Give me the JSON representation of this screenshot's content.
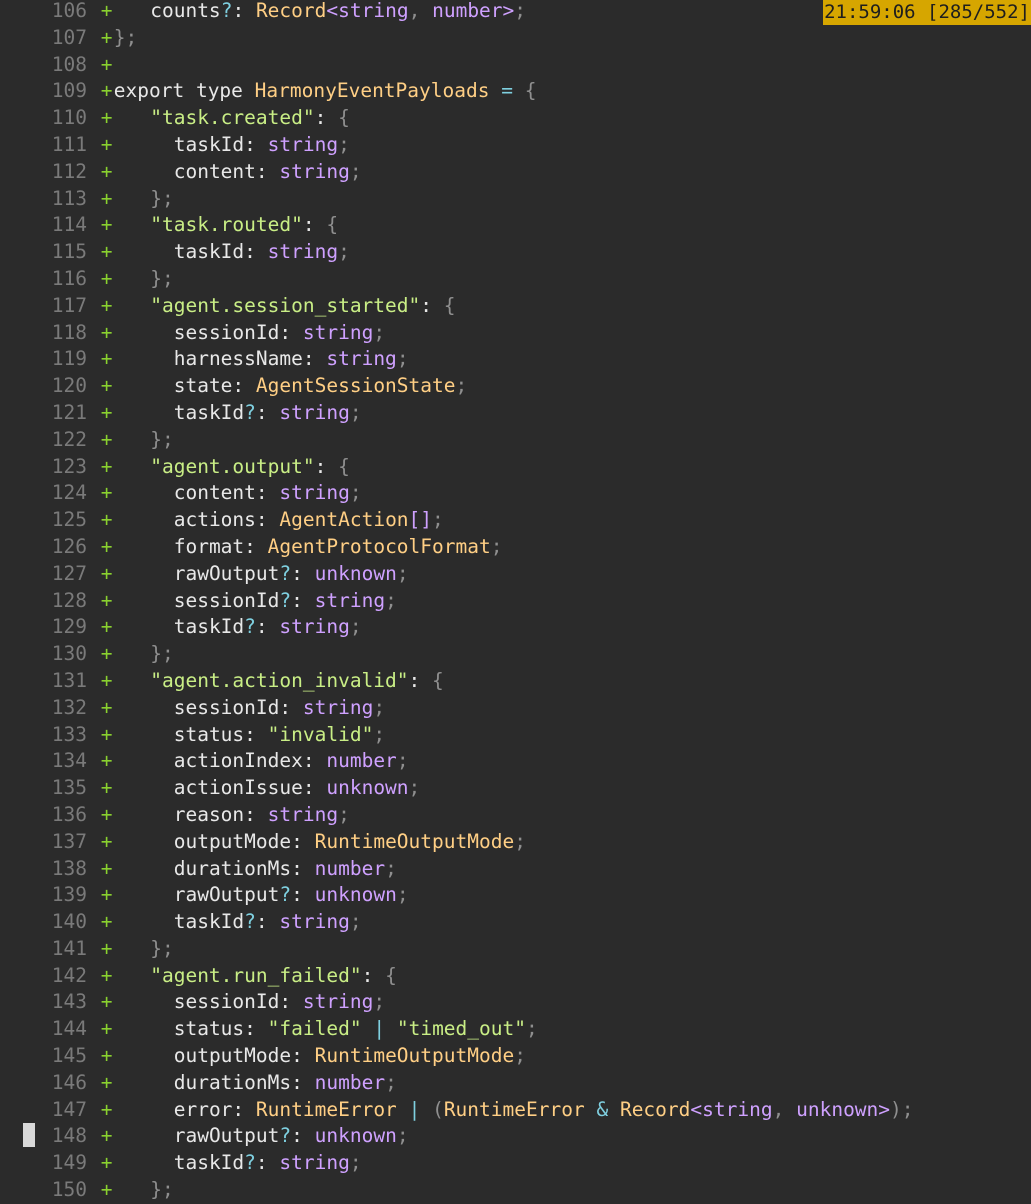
{
  "status_bar": {
    "clock": "21:59:06",
    "position": "[285/552]"
  },
  "gutter": {
    "added_marker": "+"
  },
  "colors": {
    "background": "#2b2b2b",
    "status_bg": "#d6a600",
    "added_marker": "#8ad12f",
    "line_number": "#7a7a7a"
  },
  "code_lines": [
    {
      "n": "106",
      "text": "  counts?: Record<string, number>;"
    },
    {
      "n": "107",
      "text": "};"
    },
    {
      "n": "108",
      "text": ""
    },
    {
      "n": "109",
      "text": "export type HarmonyEventPayloads = {"
    },
    {
      "n": "110",
      "text": "  \"task.created\": {"
    },
    {
      "n": "111",
      "text": "    taskId: string;"
    },
    {
      "n": "112",
      "text": "    content: string;"
    },
    {
      "n": "113",
      "text": "  };"
    },
    {
      "n": "114",
      "text": "  \"task.routed\": {"
    },
    {
      "n": "115",
      "text": "    taskId: string;"
    },
    {
      "n": "116",
      "text": "  };"
    },
    {
      "n": "117",
      "text": "  \"agent.session_started\": {"
    },
    {
      "n": "118",
      "text": "    sessionId: string;"
    },
    {
      "n": "119",
      "text": "    harnessName: string;"
    },
    {
      "n": "120",
      "text": "    state: AgentSessionState;"
    },
    {
      "n": "121",
      "text": "    taskId?: string;"
    },
    {
      "n": "122",
      "text": "  };"
    },
    {
      "n": "123",
      "text": "  \"agent.output\": {"
    },
    {
      "n": "124",
      "text": "    content: string;"
    },
    {
      "n": "125",
      "text": "    actions: AgentAction[];"
    },
    {
      "n": "126",
      "text": "    format: AgentProtocolFormat;"
    },
    {
      "n": "127",
      "text": "    rawOutput?: unknown;"
    },
    {
      "n": "128",
      "text": "    sessionId?: string;"
    },
    {
      "n": "129",
      "text": "    taskId?: string;"
    },
    {
      "n": "130",
      "text": "  };"
    },
    {
      "n": "131",
      "text": "  \"agent.action_invalid\": {"
    },
    {
      "n": "132",
      "text": "    sessionId: string;"
    },
    {
      "n": "133",
      "text": "    status: \"invalid\";"
    },
    {
      "n": "134",
      "text": "    actionIndex: number;"
    },
    {
      "n": "135",
      "text": "    actionIssue: unknown;"
    },
    {
      "n": "136",
      "text": "    reason: string;"
    },
    {
      "n": "137",
      "text": "    outputMode: RuntimeOutputMode;"
    },
    {
      "n": "138",
      "text": "    durationMs: number;"
    },
    {
      "n": "139",
      "text": "    rawOutput?: unknown;"
    },
    {
      "n": "140",
      "text": "    taskId?: string;"
    },
    {
      "n": "141",
      "text": "  };"
    },
    {
      "n": "142",
      "text": "  \"agent.run_failed\": {"
    },
    {
      "n": "143",
      "text": "    sessionId: string;"
    },
    {
      "n": "144",
      "text": "    status: \"failed\" | \"timed_out\";"
    },
    {
      "n": "145",
      "text": "    outputMode: RuntimeOutputMode;"
    },
    {
      "n": "146",
      "text": "    durationMs: number;"
    },
    {
      "n": "147",
      "text": "    error: RuntimeError | (RuntimeError & Record<string, unknown>);"
    },
    {
      "n": "148",
      "text": "    rawOutput?: unknown;"
    },
    {
      "n": "149",
      "text": "    taskId?: string;"
    },
    {
      "n": "150",
      "text": "  };"
    }
  ]
}
